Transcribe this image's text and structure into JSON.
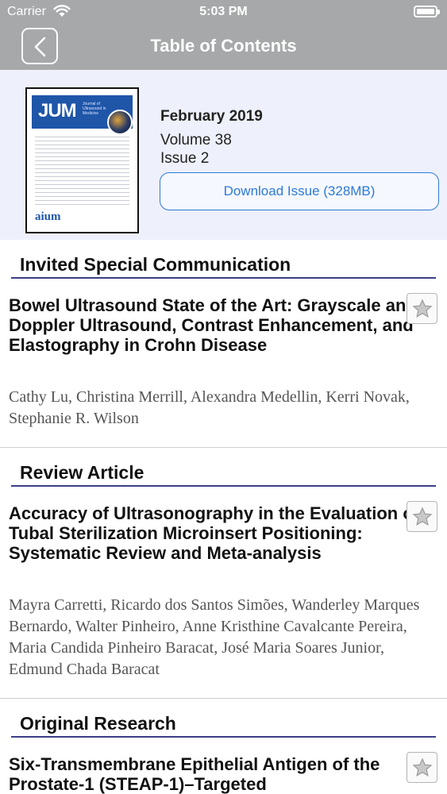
{
  "status_bar": {
    "carrier": "Carrier",
    "time": "5:03 PM"
  },
  "nav": {
    "title": "Table of Contents"
  },
  "issue": {
    "cover_logo": "JUM",
    "cover_subtitle": "Journal of Ultrasound in Medicine",
    "cover_footer": "aium",
    "date": "February 2019",
    "volume": "Volume 38",
    "issue": "Issue 2",
    "download_label": "Download Issue (328MB)"
  },
  "sections": [
    {
      "title": "Invited Special Communication",
      "article": {
        "title": "Bowel Ultrasound State of the Art: Grayscale and Doppler Ultrasound, Contrast Enhancement, and Elastography in Crohn Disease",
        "authors": "Cathy Lu, Christina Merrill, Alexandra Medellin, Kerri Novak, Stephanie R. Wilson"
      }
    },
    {
      "title": "Review Article",
      "article": {
        "title": "Accuracy of Ultrasonography in the Evaluation of Tubal Sterilization Microinsert Positioning: Systematic Review and Meta-analysis",
        "authors": "Mayra Carretti, Ricardo dos Santos Simões, Wanderley Marques Bernardo, Walter Pinheiro, Anne Kristhine Cavalcante Pereira, Maria Candida Pinheiro Baracat, José Maria Soares Junior, Edmund Chada Baracat"
      }
    },
    {
      "title": "Original Research",
      "article": {
        "title": "Six-Transmembrane Epithelial Antigen of the Prostate-1 (STEAP-1)–Targeted",
        "authors": ""
      }
    }
  ]
}
